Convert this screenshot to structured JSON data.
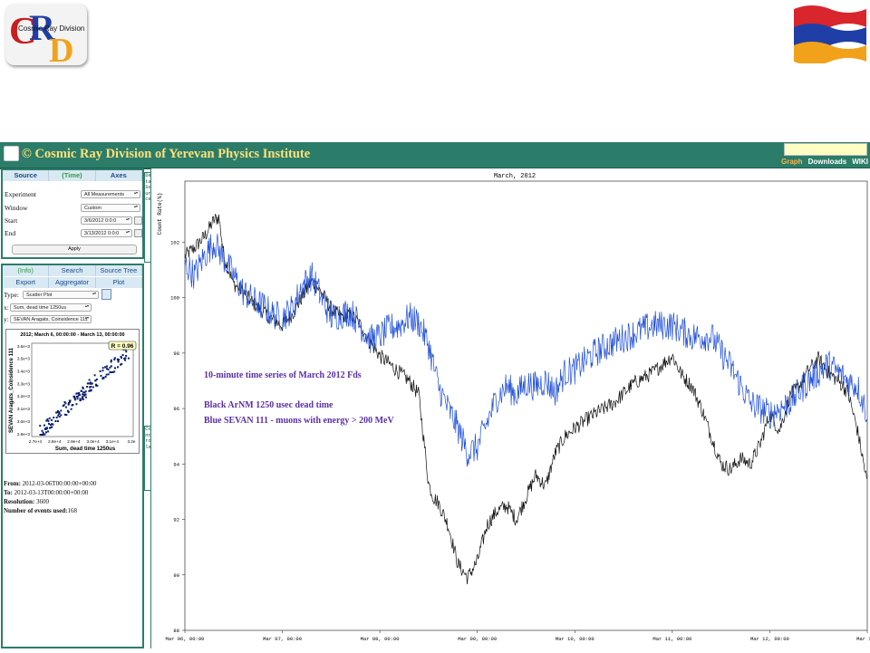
{
  "logo": {
    "text": "Cosmic Ray Division",
    "initials": [
      "C",
      "R",
      "D"
    ]
  },
  "flag": {
    "colors": [
      "#d8262c",
      "#1f3fa6",
      "#f2a21a"
    ]
  },
  "app": {
    "title": "© Cosmic Ray Division of Yerevan Physics Institute",
    "nav": [
      {
        "label": "Graph",
        "active": true
      },
      {
        "label": "Downloads",
        "active": false
      },
      {
        "label": "WIKI",
        "active": false
      }
    ]
  },
  "source_panel": {
    "tabs": [
      "Source",
      "(Time)",
      "Axes"
    ],
    "fields": {
      "experiment_label": "Experiment",
      "experiment_value": "All Measurements",
      "window_label": "Window",
      "window_value": "Custom",
      "start_label": "Start",
      "start_value": "3/6/2012 0:0:0",
      "end_label": "End",
      "end_value": "3/13/2012 0:0:0"
    },
    "apply_label": "Apply"
  },
  "side_strips": {
    "data_source": "Data Source",
    "controls": "Controls"
  },
  "plot_panel": {
    "tabs_row1": [
      "(Info)",
      "Search",
      "Source Tree"
    ],
    "tabs_row2": [
      "Export",
      "Aggregator",
      "Plot"
    ],
    "type_label": "Type:",
    "type_value": "Scatter Plot",
    "x_label": "x:",
    "x_value": "Sum, dead time 1250us",
    "y_label": "y:",
    "y_value": "SEVAN Aragats, Coinsidence 111"
  },
  "scatter": {
    "title": "2012; March 6, 00:00:00 - March 13, 00:00:00",
    "r_label": "R = 0.96",
    "xlabel": "Sum, dead time 1250us",
    "ylabel": "SEVAN Aragats_Coinsidence 111",
    "xticks": [
      "2.7e+4",
      "2.8e+4",
      "2.9e+4",
      "3.0e+4",
      "3.1e+4",
      "3.2e"
    ],
    "yticks": [
      "3.6e+3",
      "3.5e+3",
      "3.4e+3",
      "3.3e+3",
      "3.2e+3",
      "3.1e+3",
      "3.0e+3",
      "2.9e+3"
    ]
  },
  "info": {
    "from_label": "From:",
    "from_value": "2012-03-06T00:00:00+00:00",
    "to_label": "To:",
    "to_value": "2012-03-13T00:00:00+00:00",
    "resolution_label": "Resolution:",
    "resolution_value": "3600",
    "events_label": "Number of events used:",
    "events_value": "168"
  },
  "chart_data": {
    "type": "line",
    "title": "March, 2012",
    "ylabel": "Count Rate(%)",
    "xlabel": "",
    "x_ticks": [
      "Mar 06, 00:00",
      "Mar 07, 00:00",
      "Mar 08, 00:00",
      "Mar 09, 00:00",
      "Mar 10, 00:00",
      "Mar 11, 00:00",
      "Mar 12, 00:00",
      "Mar 13"
    ],
    "y_ticks": [
      "88",
      "90",
      "92",
      "94",
      "96",
      "98",
      "100",
      "102"
    ],
    "ylim": [
      88,
      104.2
    ],
    "xlim": [
      0,
      7
    ],
    "annotations": [
      "10-minute time series of March 2012 Fds",
      "Black ArNM 1250 usec dead time",
      "Blue SEVAN 111 - muons with energy > 200 MeV"
    ],
    "series": [
      {
        "color": "#111111",
        "x": [
          0,
          0.1,
          0.2,
          0.3,
          0.35,
          0.4,
          0.5,
          0.6,
          0.7,
          0.8,
          0.9,
          1.0,
          1.1,
          1.2,
          1.3,
          1.4,
          1.5,
          1.6,
          1.7,
          1.8,
          1.9,
          2.0,
          2.1,
          2.2,
          2.3,
          2.4,
          2.5,
          2.55,
          2.6,
          2.7,
          2.8,
          2.9,
          3.0,
          3.1,
          3.2,
          3.3,
          3.4,
          3.5,
          3.6,
          3.7,
          3.8,
          3.9,
          4.0,
          4.2,
          4.4,
          4.6,
          4.8,
          5.0,
          5.1,
          5.2,
          5.3,
          5.4,
          5.5,
          5.6,
          5.7,
          5.8,
          5.9,
          6.0,
          6.1,
          6.2,
          6.3,
          6.4,
          6.5,
          6.6,
          6.7,
          6.8,
          6.9,
          7.0
        ],
        "y": [
          101.5,
          101.8,
          102.2,
          102.8,
          102.9,
          101.5,
          100.5,
          100.2,
          99.8,
          99.5,
          99.2,
          99.0,
          99.4,
          100.0,
          100.6,
          100.2,
          99.6,
          99.3,
          99.4,
          99.0,
          98.4,
          97.9,
          97.6,
          97.3,
          97.0,
          96.5,
          93.3,
          92.8,
          92.6,
          91.8,
          90.4,
          89.9,
          90.5,
          91.8,
          92.3,
          92.5,
          92.0,
          92.8,
          93.6,
          93.2,
          94.4,
          95.0,
          95.3,
          95.8,
          96.2,
          96.9,
          97.3,
          97.9,
          97.2,
          96.8,
          96.0,
          95.0,
          94.0,
          93.8,
          94.2,
          94.0,
          94.7,
          95.8,
          95.2,
          96.4,
          96.8,
          97.4,
          97.8,
          97.3,
          97.0,
          96.6,
          95.2,
          93.3
        ]
      },
      {
        "color": "#1f4fd8",
        "x": [
          0,
          0.1,
          0.2,
          0.3,
          0.4,
          0.5,
          0.6,
          0.7,
          0.8,
          0.9,
          1.0,
          1.1,
          1.2,
          1.3,
          1.4,
          1.5,
          1.6,
          1.7,
          1.8,
          1.9,
          2.0,
          2.1,
          2.2,
          2.3,
          2.4,
          2.5,
          2.6,
          2.7,
          2.8,
          2.9,
          3.0,
          3.1,
          3.2,
          3.3,
          3.4,
          3.5,
          3.6,
          3.7,
          3.8,
          3.9,
          4.0,
          4.2,
          4.4,
          4.6,
          4.8,
          5.0,
          5.2,
          5.4,
          5.6,
          5.8,
          6.0,
          6.2,
          6.4,
          6.6,
          6.8,
          6.9,
          7.0
        ],
        "y": [
          101.2,
          100.8,
          101.5,
          102.0,
          101.4,
          100.8,
          100.2,
          99.9,
          99.7,
          99.4,
          99.3,
          99.6,
          100.4,
          100.8,
          100.0,
          99.3,
          99.4,
          99.5,
          99.0,
          98.5,
          98.6,
          98.9,
          99.0,
          99.3,
          99.1,
          98.3,
          96.8,
          96.0,
          95.3,
          94.4,
          94.6,
          95.5,
          96.4,
          96.8,
          96.5,
          96.9,
          96.8,
          97.0,
          96.6,
          97.3,
          97.4,
          98.0,
          98.4,
          98.7,
          99.0,
          99.0,
          98.6,
          98.6,
          97.5,
          96.2,
          95.8,
          96.2,
          97.0,
          97.6,
          97.0,
          96.8,
          95.8
        ]
      }
    ]
  }
}
